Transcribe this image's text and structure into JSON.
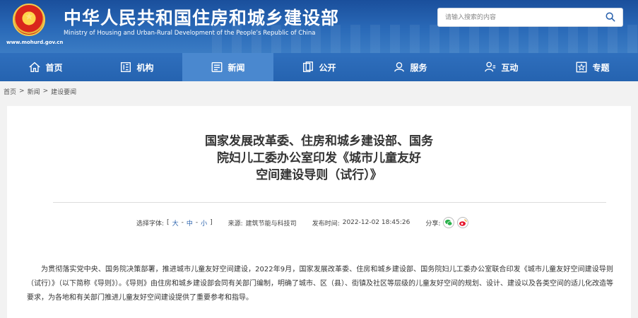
{
  "header": {
    "title_cn": "中华人民共和国住房和城乡建设部",
    "title_en": "Ministry of Housing and Urban-Rural Development of the People’s Republic of China",
    "url": "www.mohurd.gov.cn",
    "search_placeholder": "请输入搜索的内容",
    "icons": {
      "emblem": "national-emblem",
      "search": "magnifier-icon"
    }
  },
  "nav": {
    "items": [
      {
        "label": "首页",
        "icon": "home-icon",
        "active": false
      },
      {
        "label": "机构",
        "icon": "org-icon",
        "active": false
      },
      {
        "label": "新闻",
        "icon": "news-icon",
        "active": true
      },
      {
        "label": "公开",
        "icon": "open-icon",
        "active": false
      },
      {
        "label": "服务",
        "icon": "service-icon",
        "active": false
      },
      {
        "label": "互动",
        "icon": "interact-icon",
        "active": false
      },
      {
        "label": "专题",
        "icon": "topic-icon",
        "active": false
      }
    ]
  },
  "breadcrumb": {
    "items": [
      "首页",
      "新闻",
      "建设要闻"
    ],
    "sep": ">"
  },
  "article": {
    "title_lines": [
      "国家发展改革委、住房和城乡建设部、国务",
      "院妇儿工委办公室印发《城市儿童友好",
      "空间建设导则（试行）》"
    ],
    "meta": {
      "font_label": "选择字体:",
      "font_open": "[",
      "font_large": "大",
      "font_mid": "中",
      "font_small": "小",
      "font_close": "]",
      "font_dash": "-",
      "source_label": "来源:",
      "source": "建筑节能与科技司",
      "time_label": "发布时间:",
      "time": "2022-12-02 18:45:26",
      "share_label": "分享:"
    },
    "body": "为贯彻落实党中央、国务院决策部署，推进城市儿童友好空间建设，2022年9月，国家发展改革委、住房和城乡建设部、国务院妇儿工委办公室联合印发《城市儿童友好空间建设导则（试行）》（以下简称《导则》）。《导则》由住房和城乡建设部会同有关部门编制，明确了城市、区（县）、街镇及社区等层级的儿童友好空间的规划、设计、建设以及各类空间的适儿化改造等要求，为各地和有关部门推进儿童友好空间建设提供了重要参考和指导。"
  },
  "colors": {
    "header": "#2a6ab8",
    "nav": "#2563b0",
    "nav_active": "#4a88cf",
    "link": "#2a62ad",
    "wechat": "#2bb24c",
    "weibo": "#e6162d"
  }
}
